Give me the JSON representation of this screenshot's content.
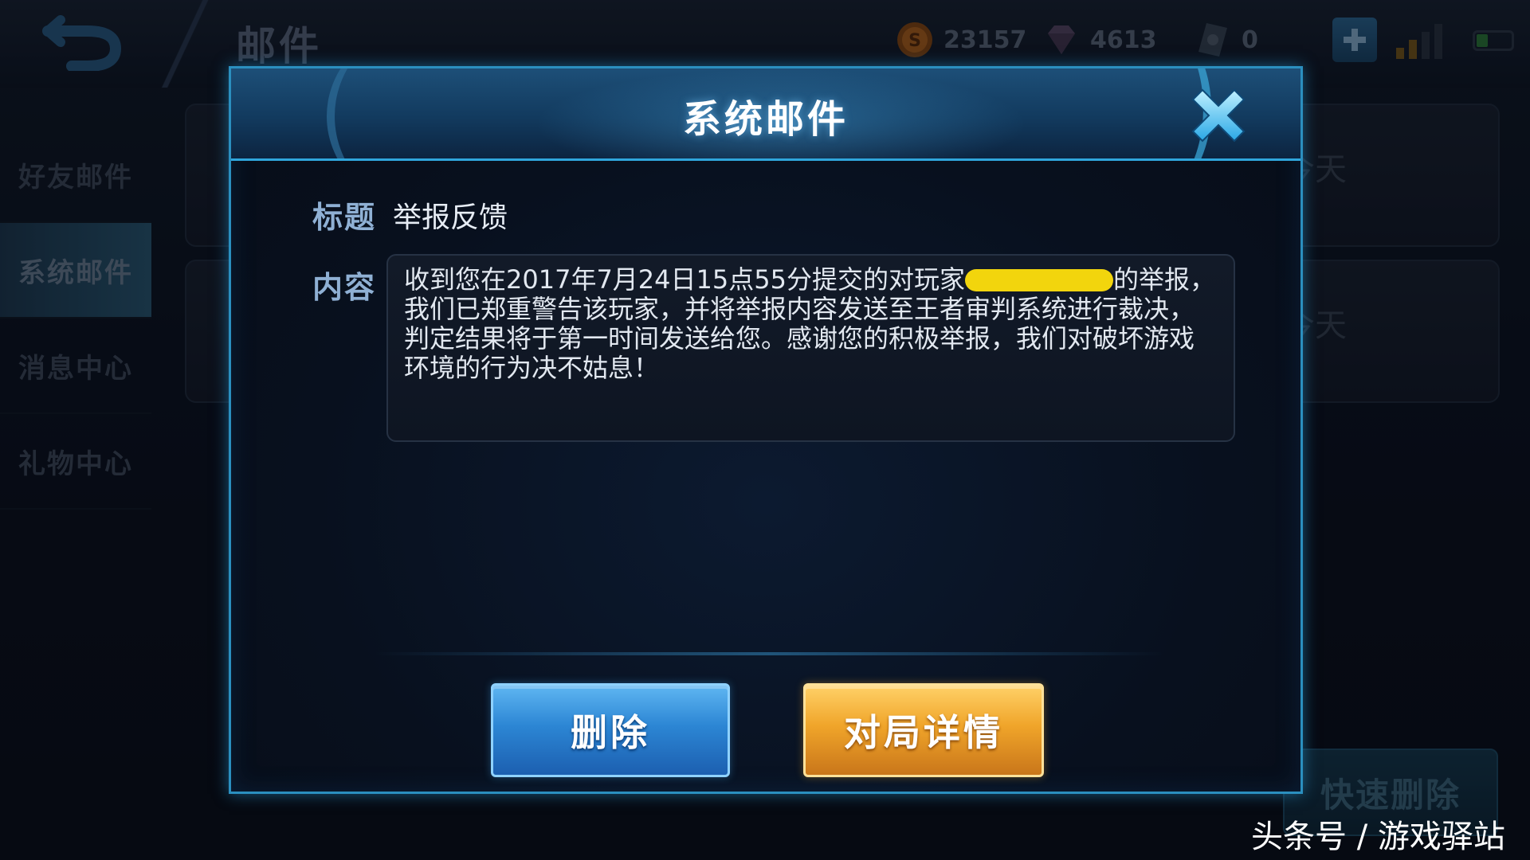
{
  "header": {
    "page_title": "邮件",
    "currencies": [
      {
        "icon": "gold-coin-icon",
        "value": "23157"
      },
      {
        "icon": "diamond-icon",
        "value": "4613"
      },
      {
        "icon": "voucher-icon",
        "value": "0"
      }
    ]
  },
  "sidebar": {
    "items": [
      {
        "label": "好友邮件",
        "active": false
      },
      {
        "label": "系统邮件",
        "active": true
      },
      {
        "label": "消息中心",
        "active": false
      },
      {
        "label": "礼物中心",
        "active": false
      }
    ]
  },
  "mail_list": {
    "items": [
      {
        "date": "今天"
      },
      {
        "date": "今天"
      }
    ],
    "quick_delete_label": "快速删除"
  },
  "modal": {
    "title": "系统邮件",
    "subject_label": "标题",
    "subject_value": "举报反馈",
    "content_label": "内容",
    "content_before_redaction": "收到您在2017年7月24日15点55分提交的对玩家",
    "content_after_redaction": "的举报，我们已郑重警告该玩家，并将举报内容发送至王者审判系统进行裁决，判定结果将于第一时间发送给您。感谢您的积极举报，我们对破坏游戏环境的行为决不姑息！",
    "delete_button": "删除",
    "details_button": "对局详情"
  },
  "watermark": "头条号 / 游戏驿站",
  "colors": {
    "modal_border": "#2b8fbf",
    "delete_button": "#2c86d4",
    "details_button": "#f0a52a",
    "redaction": "#f2d50d"
  }
}
